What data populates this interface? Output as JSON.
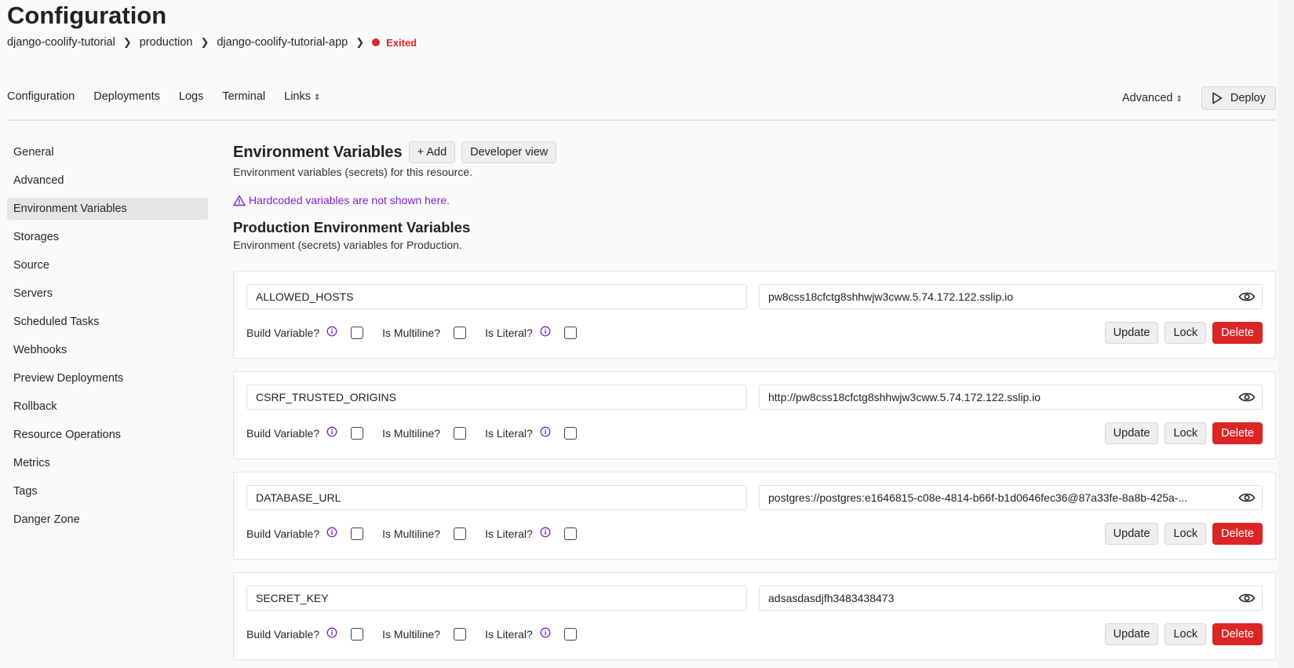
{
  "title": "Configuration",
  "breadcrumb": [
    "django-coolify-tutorial",
    "production",
    "django-coolify-tutorial-app"
  ],
  "status": {
    "label": "Exited",
    "color": "#dc2626"
  },
  "nav": {
    "tabs": [
      "Configuration",
      "Deployments",
      "Logs",
      "Terminal",
      "Links"
    ],
    "advanced": "Advanced",
    "deploy": "Deploy"
  },
  "sidebar": {
    "items": [
      "General",
      "Advanced",
      "Environment Variables",
      "Storages",
      "Source",
      "Servers",
      "Scheduled Tasks",
      "Webhooks",
      "Preview Deployments",
      "Rollback",
      "Resource Operations",
      "Metrics",
      "Tags",
      "Danger Zone"
    ],
    "active": "Environment Variables"
  },
  "main": {
    "heading": "Environment Variables",
    "add": "+ Add",
    "developer_view": "Developer view",
    "description": "Environment variables (secrets) for this resource.",
    "warning": "Hardcoded variables are not shown here.",
    "prod_heading": "Production Environment Variables",
    "prod_description": "Environment (secrets) variables for Production."
  },
  "labels": {
    "build": "Build Variable?",
    "multiline": "Is Multiline?",
    "literal": "Is Literal?",
    "update": "Update",
    "lock": "Lock",
    "delete": "Delete"
  },
  "variables": [
    {
      "key": "ALLOWED_HOSTS",
      "value": "pw8css18cfctg8shhwjw3cww.5.74.172.122.sslip.io",
      "build": false,
      "multiline": false,
      "literal": false
    },
    {
      "key": "CSRF_TRUSTED_ORIGINS",
      "value": "http://pw8css18cfctg8shhwjw3cww.5.74.172.122.sslip.io",
      "build": false,
      "multiline": false,
      "literal": false
    },
    {
      "key": "DATABASE_URL",
      "value": "postgres://postgres:e1646815-c08e-4814-b66f-b1d0646fec36@87a33fe-8a8b-425a-...",
      "build": false,
      "multiline": false,
      "literal": false
    },
    {
      "key": "SECRET_KEY",
      "value": "adsasdasdjfh3483438473",
      "build": false,
      "multiline": false,
      "literal": false
    }
  ],
  "colors": {
    "accent": "#7e22ce",
    "danger": "#dc2626"
  }
}
